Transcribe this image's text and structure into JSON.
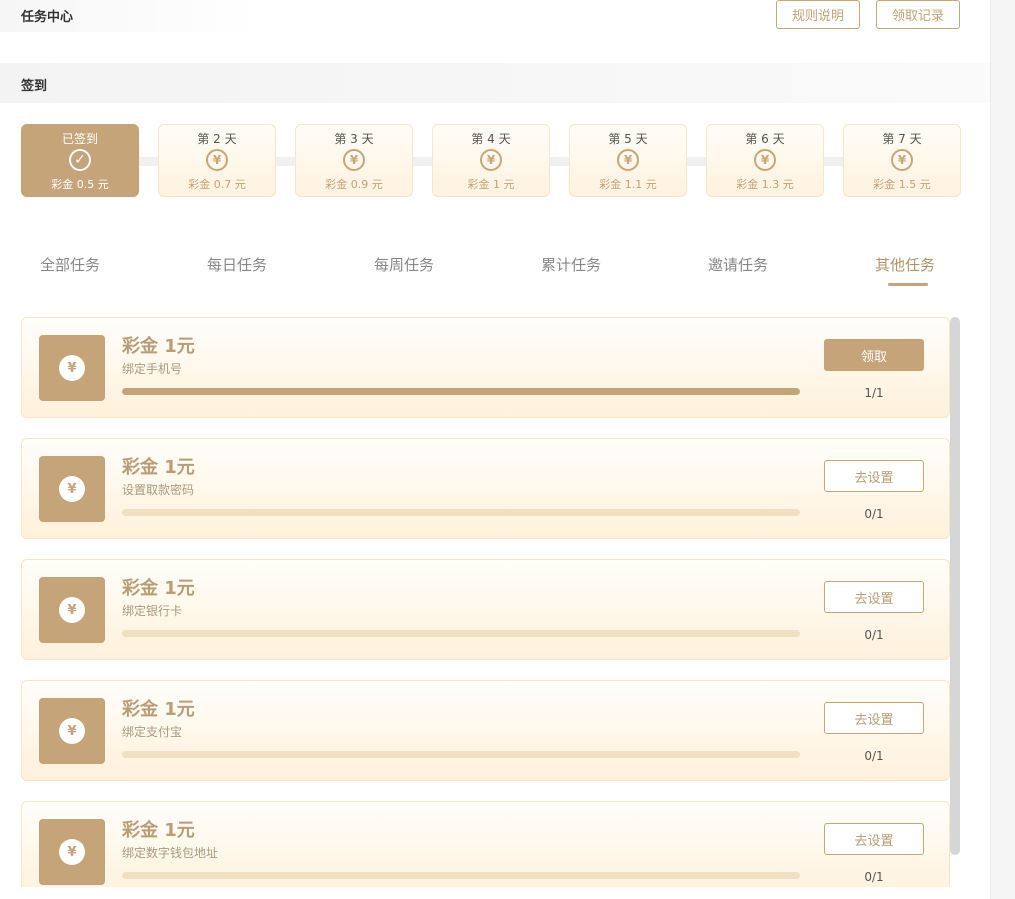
{
  "header": {
    "title": "任务中心",
    "rules_label": "规则说明",
    "records_label": "领取记录"
  },
  "checkin": {
    "section_label": "签到",
    "days": [
      {
        "title": "已签到",
        "amount": "彩金 0.5 元",
        "checked": true
      },
      {
        "title": "第 2 天",
        "amount": "彩金 0.7 元",
        "checked": false
      },
      {
        "title": "第 3 天",
        "amount": "彩金 0.9 元",
        "checked": false
      },
      {
        "title": "第 4 天",
        "amount": "彩金 1 元",
        "checked": false
      },
      {
        "title": "第 5 天",
        "amount": "彩金 1.1 元",
        "checked": false
      },
      {
        "title": "第 6 天",
        "amount": "彩金 1.3 元",
        "checked": false
      },
      {
        "title": "第 7 天",
        "amount": "彩金 1.5 元",
        "checked": false
      }
    ],
    "checked_glyph": "✓",
    "coin_glyph": "¥"
  },
  "tabs": [
    {
      "label": "全部任务",
      "active": false
    },
    {
      "label": "每日任务",
      "active": false
    },
    {
      "label": "每周任务",
      "active": false
    },
    {
      "label": "累计任务",
      "active": false
    },
    {
      "label": "邀请任务",
      "active": false
    },
    {
      "label": "其他任务",
      "active": true
    }
  ],
  "tasks": [
    {
      "amount": "彩金 1元",
      "desc": "绑定手机号",
      "progress_text": "1/1",
      "progress": 1.0,
      "button": "领取",
      "button_type": "claim"
    },
    {
      "amount": "彩金 1元",
      "desc": "设置取款密码",
      "progress_text": "0/1",
      "progress": 0.0,
      "button": "去设置",
      "button_type": "go"
    },
    {
      "amount": "彩金 1元",
      "desc": "绑定银行卡",
      "progress_text": "0/1",
      "progress": 0.0,
      "button": "去设置",
      "button_type": "go"
    },
    {
      "amount": "彩金 1元",
      "desc": "绑定支付宝",
      "progress_text": "0/1",
      "progress": 0.0,
      "button": "去设置",
      "button_type": "go"
    },
    {
      "amount": "彩金 1元",
      "desc": "绑定数字钱包地址",
      "progress_text": "0/1",
      "progress": 0.0,
      "button": "去设置",
      "button_type": "go"
    }
  ],
  "icons": {
    "coin": "yen-coin-icon",
    "check": "check-circle-icon"
  },
  "colors": {
    "accent": "#c4a478",
    "accent_text": "#b89d75",
    "card_border": "#f8e6c8"
  }
}
